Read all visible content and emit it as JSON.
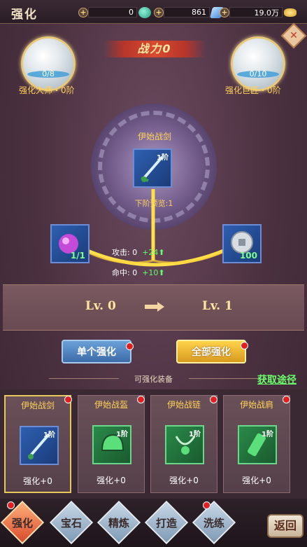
{
  "header": {
    "title": "强化",
    "resources": [
      {
        "value": "0",
        "icon": "jade-icon"
      },
      {
        "value": "861",
        "icon": "crystal-icon"
      },
      {
        "value": "19.0万",
        "icon": "gold-ingot-icon"
      }
    ]
  },
  "power": {
    "label": "战力0"
  },
  "master_left": {
    "progress": "0/8",
    "label": "强化大师・0阶"
  },
  "master_right": {
    "progress": "0/10",
    "label": "强化巨匠・0阶"
  },
  "current_item": {
    "name": "伊始战剑",
    "tier": "1阶",
    "preview": "下阶预览:1"
  },
  "materials": [
    {
      "count": "1/1",
      "icon": "purple-gem-icon"
    },
    {
      "count": "100",
      "icon": "silver-coin-icon"
    }
  ],
  "stats": [
    {
      "label": "攻击: 0",
      "bonus": "+24"
    },
    {
      "label": "命中: 0",
      "bonus": "+10"
    }
  ],
  "level": {
    "from": "Lv. 0",
    "to": "Lv. 1"
  },
  "buttons": {
    "single": "单个强化",
    "all": "全部强化",
    "get_way": "获取途径"
  },
  "section_title": "可强化装备",
  "equipment": [
    {
      "name": "伊始战剑",
      "tier": "1阶",
      "level": "强化+0",
      "icon": "sword-icon"
    },
    {
      "name": "伊始战盔",
      "tier": "1阶",
      "level": "强化+0",
      "icon": "helmet-icon"
    },
    {
      "name": "伊始战链",
      "tier": "1阶",
      "level": "强化+0",
      "icon": "necklace-icon"
    },
    {
      "name": "伊始战肩",
      "tier": "1阶",
      "level": "强化+0",
      "icon": "shoulder-icon"
    }
  ],
  "nav": [
    {
      "label": "强化"
    },
    {
      "label": "宝石"
    },
    {
      "label": "精炼"
    },
    {
      "label": "打造"
    },
    {
      "label": "洗练"
    }
  ],
  "back": "返回"
}
